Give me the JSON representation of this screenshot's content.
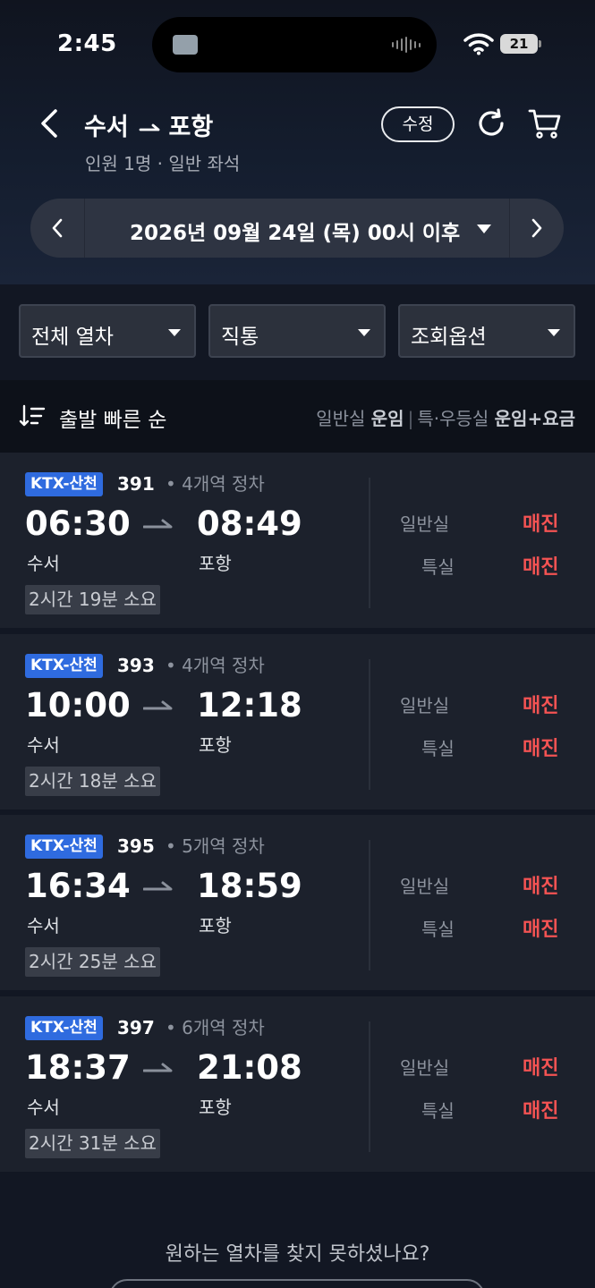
{
  "status": {
    "time": "2:45",
    "battery": "21"
  },
  "header": {
    "origin": "수서",
    "destination": "포항",
    "subtitle": "인원 1명 · 일반 좌석",
    "edit_label": "수정"
  },
  "date": {
    "label": "2026년 09월 24일 (목) 00시 이후"
  },
  "filters": [
    {
      "label": "전체 열차"
    },
    {
      "label": "직통"
    },
    {
      "label": "조회옵션"
    }
  ],
  "sort": {
    "label": "출발 빠른 순",
    "legend_general_prefix": "일반실",
    "legend_general_bold": "운임",
    "legend_special_prefix": "특·우등실",
    "legend_special_bold": "운임+요금"
  },
  "trains": [
    {
      "type": "KTX-산천",
      "number": "391",
      "stops": "• 4개역 정차",
      "dep_time": "06:30",
      "arr_time": "08:49",
      "dep_station": "수서",
      "arr_station": "포항",
      "duration": "2시간 19분 소요",
      "class1": "일반실",
      "class1_status": "매진",
      "class2": "특실",
      "class2_status": "매진"
    },
    {
      "type": "KTX-산천",
      "number": "393",
      "stops": "• 4개역 정차",
      "dep_time": "10:00",
      "arr_time": "12:18",
      "dep_station": "수서",
      "arr_station": "포항",
      "duration": "2시간 18분 소요",
      "class1": "일반실",
      "class1_status": "매진",
      "class2": "특실",
      "class2_status": "매진"
    },
    {
      "type": "KTX-산천",
      "number": "395",
      "stops": "• 5개역 정차",
      "dep_time": "16:34",
      "arr_time": "18:59",
      "dep_station": "수서",
      "arr_station": "포항",
      "duration": "2시간 25분 소요",
      "class1": "일반실",
      "class1_status": "매진",
      "class2": "특실",
      "class2_status": "매진"
    },
    {
      "type": "KTX-산천",
      "number": "397",
      "stops": "• 6개역 정차",
      "dep_time": "18:37",
      "arr_time": "21:08",
      "dep_station": "수서",
      "arr_station": "포항",
      "duration": "2시간 31분 소요",
      "class1": "일반실",
      "class1_status": "매진",
      "class2": "특실",
      "class2_status": "매진"
    }
  ],
  "footer": {
    "not_found": "원하는 열차를 찾지 못하셨나요?"
  },
  "colors": {
    "accent_badge": "#2f6bdf",
    "soldout": "#f45353",
    "background": "#121723"
  }
}
